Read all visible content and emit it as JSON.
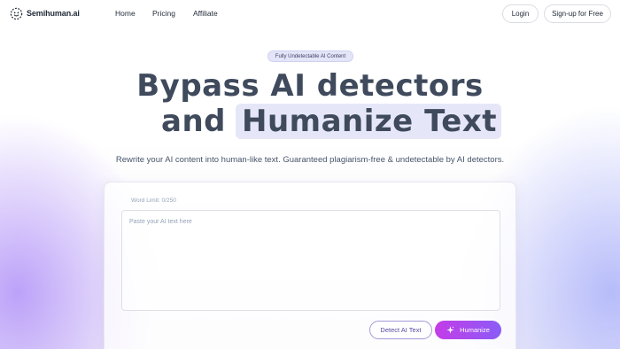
{
  "header": {
    "brand": "Semihuman.ai",
    "logo_icon": "smiley-dashed-icon",
    "nav": [
      {
        "label": "Home"
      },
      {
        "label": "Pricing"
      },
      {
        "label": "Affiliate"
      }
    ],
    "login_label": "Login",
    "signup_label": "Sign-up for Free"
  },
  "hero": {
    "badge": "Fully Undetectable AI Content",
    "headline_line1": "Bypass AI detectors",
    "headline_line2_prefix": "and",
    "headline_line2_highlight": "Humanize Text",
    "subtitle": "Rewrite your AI content into human-like text. Guaranteed plagiarism-free & undetectable by AI detectors."
  },
  "editor": {
    "word_limit": "Word Limit: 0/250",
    "placeholder": "Paste your AI text here",
    "value": "",
    "detect_label": "Detect AI Text",
    "humanize_label": "Humanize",
    "humanize_icon": "sparkle-icon"
  },
  "colors": {
    "accent_start": "#c43ce8",
    "accent_end": "#8b5cf6",
    "headline": "#3f4a5c",
    "highlight_bg": "#e5e7f8"
  }
}
